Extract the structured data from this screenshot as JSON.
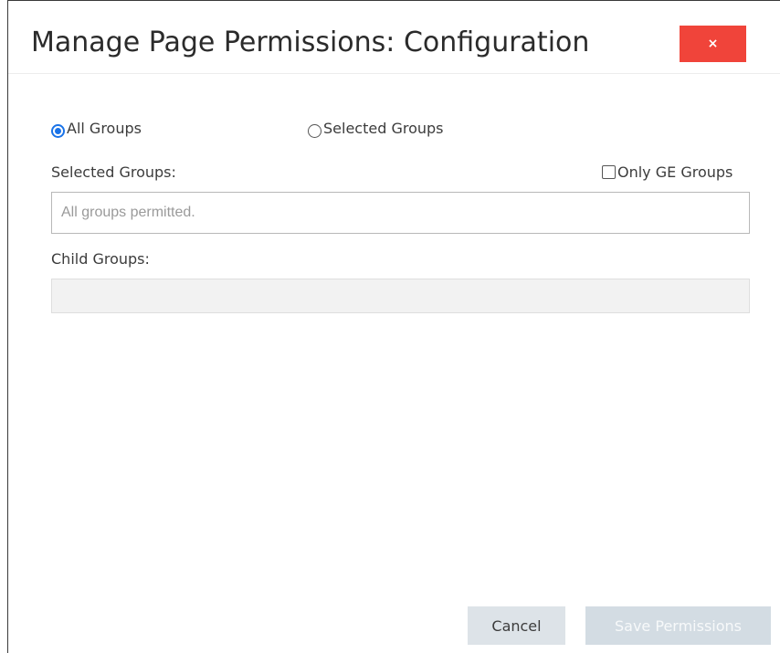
{
  "dialog": {
    "title": "Manage Page Permissions: Configuration",
    "close_label": "×"
  },
  "groups": {
    "option_all": "All Groups",
    "option_selected": "Selected Groups",
    "selected_option": "All Groups",
    "selected_groups_label": "Selected Groups:",
    "only_ge_label": "Only GE Groups",
    "only_ge_checked": false,
    "selected_groups_placeholder": "All groups permitted.",
    "selected_groups_value": "",
    "child_groups_label": "Child Groups:",
    "child_groups_value": ""
  },
  "footer": {
    "cancel_label": "Cancel",
    "save_label": "Save Permissions"
  },
  "colors": {
    "close_button": "#f0443a",
    "radio_accent": "#1a73e8",
    "cancel_button": "#dde3e8",
    "save_button_disabled": "#d3dce3"
  }
}
